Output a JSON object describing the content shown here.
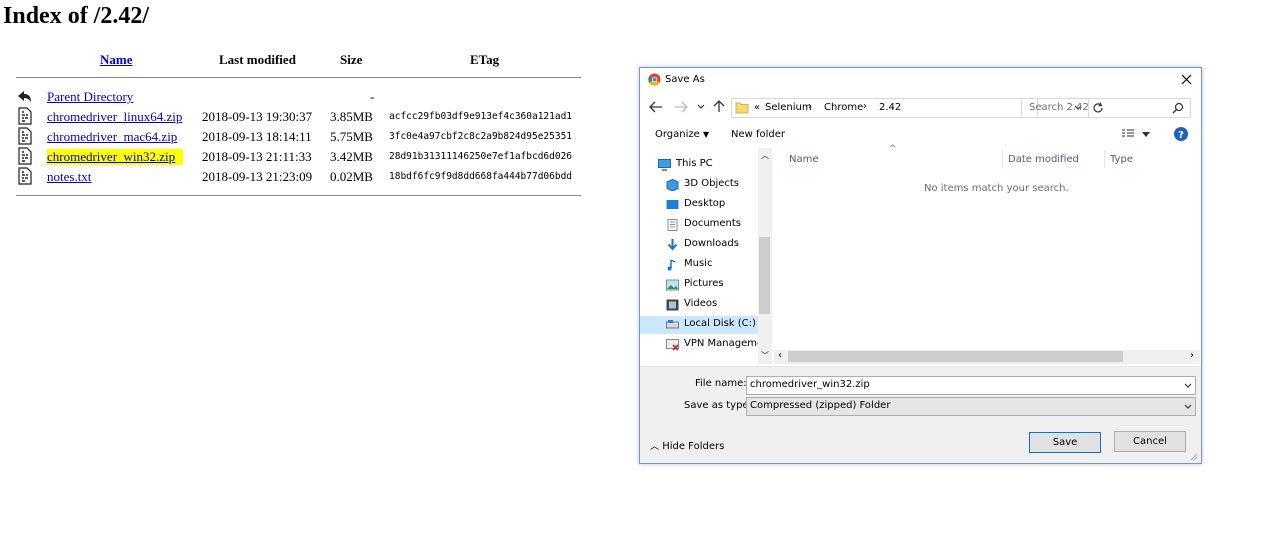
{
  "page": {
    "title": "Index of /2.42/"
  },
  "listing": {
    "headers": {
      "name": "Name",
      "modified": "Last modified",
      "size": "Size",
      "etag": "ETag"
    },
    "rows": [
      {
        "name": "Parent Directory",
        "modified": "",
        "size": "-",
        "etag": "",
        "icon": "back-icon"
      },
      {
        "name": "chromedriver_linux64.zip",
        "modified": "2018-09-13 19:30:37",
        "size": "3.85MB",
        "etag": "acfcc29fb03df9e913ef4c360a121ad1",
        "icon": "binary-file-icon"
      },
      {
        "name": "chromedriver_mac64.zip",
        "modified": "2018-09-13 18:14:11",
        "size": "5.75MB",
        "etag": "3fc0e4a97cbf2c8c2a9b824d95e25351",
        "icon": "binary-file-icon"
      },
      {
        "name": "chromedriver_win32.zip",
        "modified": "2018-09-13 21:11:33",
        "size": "3.42MB",
        "etag": "28d91b31311146250e7ef1afbcd6d026",
        "icon": "binary-file-icon",
        "highlighted": true
      },
      {
        "name": "notes.txt",
        "modified": "2018-09-13 21:23:09",
        "size": "0.02MB",
        "etag": "18bdf6fc9f9d8dd668fa444b77d06bdd",
        "icon": "binary-file-icon"
      }
    ]
  },
  "dialog": {
    "title": "Save As",
    "breadcrumb": {
      "overflow": "«",
      "items": [
        "Selenium",
        "Chrome",
        "2.42"
      ]
    },
    "search_placeholder": "Search 2.42",
    "toolbar": {
      "organize": "Organize",
      "new_folder": "New folder"
    },
    "nav": [
      {
        "label": "This PC",
        "icon": "computer-icon"
      },
      {
        "label": "3D Objects",
        "icon": "3d-objects-icon"
      },
      {
        "label": "Desktop",
        "icon": "desktop-icon"
      },
      {
        "label": "Documents",
        "icon": "documents-icon"
      },
      {
        "label": "Downloads",
        "icon": "downloads-icon"
      },
      {
        "label": "Music",
        "icon": "music-icon"
      },
      {
        "label": "Pictures",
        "icon": "pictures-icon"
      },
      {
        "label": "Videos",
        "icon": "videos-icon"
      },
      {
        "label": "Local Disk (C:)",
        "icon": "drive-icon",
        "selected": true
      },
      {
        "label": "VPN Manageme",
        "icon": "vpn-icon"
      }
    ],
    "columns": {
      "name": "Name",
      "modified": "Date modified",
      "type": "Type"
    },
    "empty_message": "No items match your search.",
    "file_name_label": "File name:",
    "file_name_value": "chromedriver_win32.zip",
    "save_as_type_label": "Save as type:",
    "save_as_type_value": "Compressed (zipped) Folder",
    "hide_folders": "Hide Folders",
    "save": "Save",
    "cancel": "Cancel",
    "colors": {
      "accent": "#0078d7",
      "selection": "#cce8ff"
    }
  }
}
